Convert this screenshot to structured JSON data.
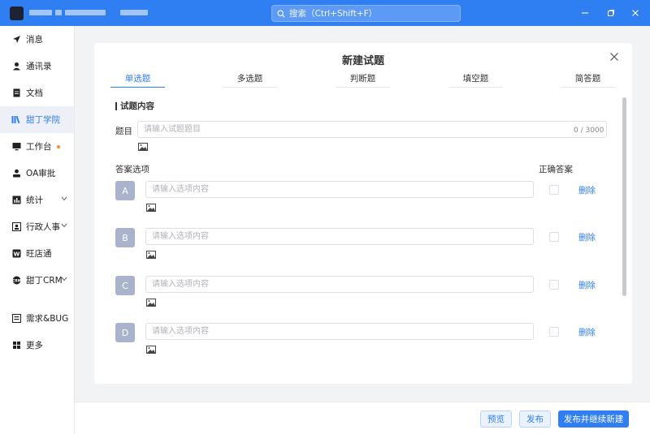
{
  "search": {
    "text": "搜索（Ctrl+Shift+F）"
  },
  "sidebar": {
    "items": [
      {
        "label": "消息",
        "icon": "send-icon"
      },
      {
        "label": "通讯录",
        "icon": "person-icon"
      },
      {
        "label": "文档",
        "icon": "document-icon"
      },
      {
        "label": "甜丁学院",
        "icon": "books-icon"
      },
      {
        "label": "工作台",
        "icon": "monitor-icon"
      },
      {
        "label": "OA审批",
        "icon": "stamp-icon"
      },
      {
        "label": "统计",
        "icon": "chart-icon"
      },
      {
        "label": "行政人事",
        "icon": "badge-icon"
      },
      {
        "label": "旺店通",
        "icon": "store-icon"
      },
      {
        "label": "甜丁CRM",
        "icon": "crm-icon"
      },
      {
        "label": "需求&BUG",
        "icon": "bug-icon"
      },
      {
        "label": "更多",
        "icon": "grid-icon"
      }
    ]
  },
  "modal": {
    "title": "新建试题",
    "tabs": [
      "单选题",
      "多选题",
      "判断题",
      "填空题",
      "简答题"
    ],
    "section_title": "试题内容",
    "question_label": "题目",
    "question_placeholder": "请输入试题题目",
    "counter": "0 / 3000",
    "options_label": "答案选项",
    "correct_label": "正确答案",
    "options": [
      {
        "letter": "A",
        "placeholder": "请输入选项内容",
        "delete": "删除"
      },
      {
        "letter": "B",
        "placeholder": "请输入选项内容",
        "delete": "删除"
      },
      {
        "letter": "C",
        "placeholder": "请输入选项内容",
        "delete": "删除"
      },
      {
        "letter": "D",
        "placeholder": "请输入选项内容",
        "delete": "删除"
      }
    ]
  },
  "footer": {
    "preview": "预览",
    "publish": "发布",
    "publish_continue": "发布并继续新建"
  },
  "colors": {
    "accent": "#2f7ef2",
    "letter_bg": "#a9b4cc",
    "badge_dot": "#f08a3c"
  }
}
